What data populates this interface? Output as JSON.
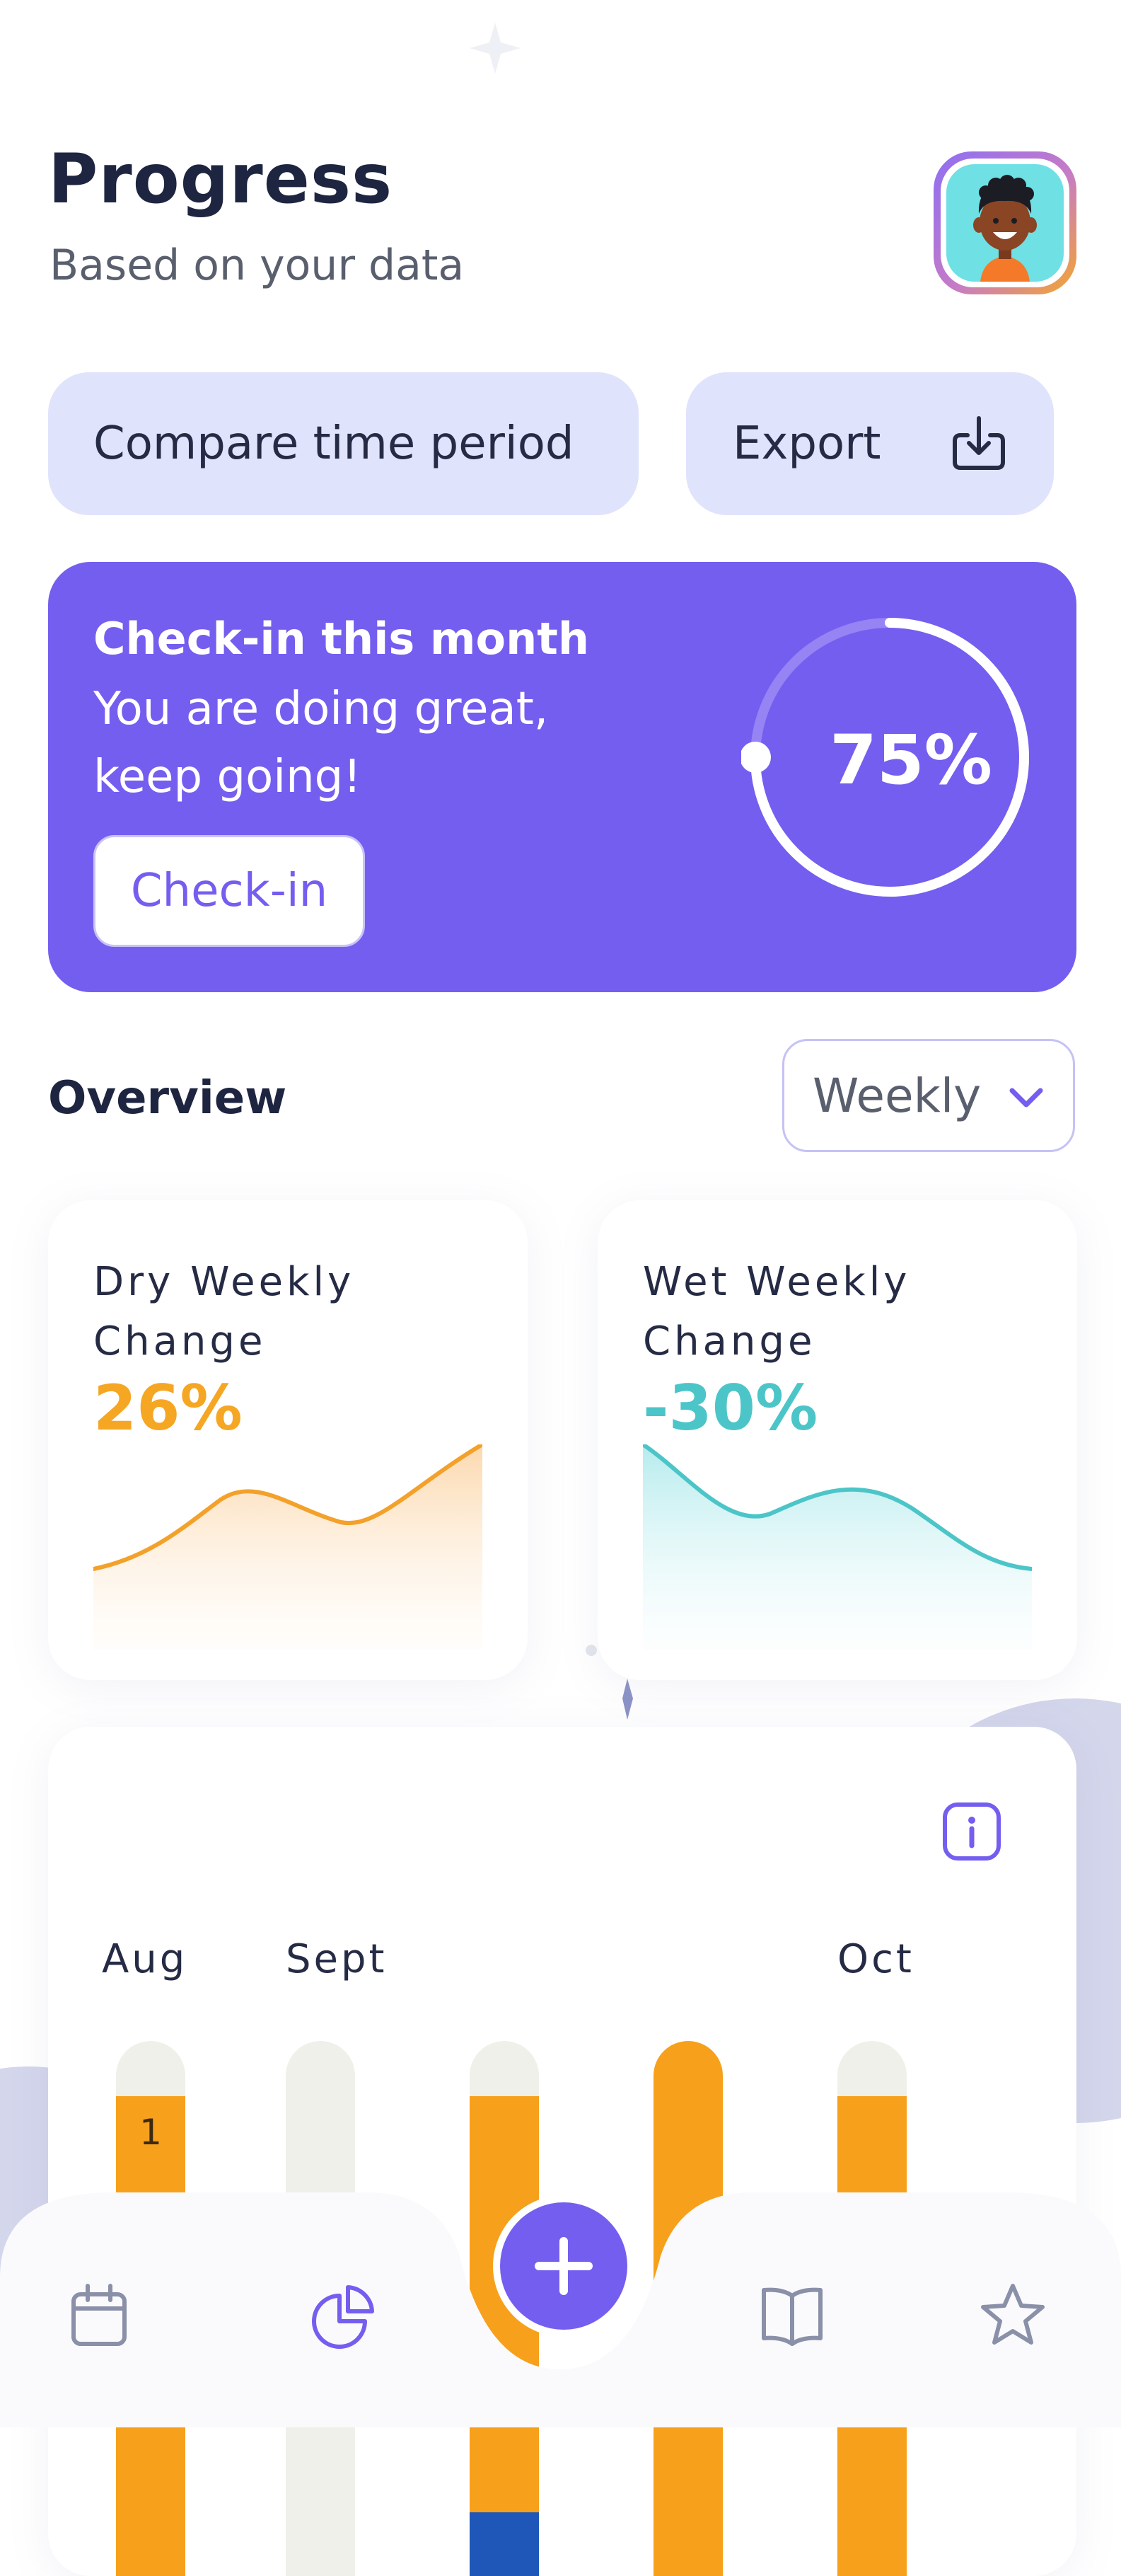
{
  "header": {
    "title": "Progress",
    "subtitle": "Based on your data"
  },
  "actions": {
    "compare_label": "Compare time period",
    "export_label": "Export"
  },
  "checkin": {
    "title": "Check-in this month",
    "message": "You are doing great, keep going!",
    "button_label": "Check-in",
    "progress_text": "75%",
    "progress": 0.75
  },
  "overview": {
    "title": "Overview",
    "period": "Weekly"
  },
  "stats": {
    "dry": {
      "label": "Dry Weekly Change",
      "value": "26%",
      "color": "#f5a623"
    },
    "wet": {
      "label": "Wet Weekly Change",
      "value": "-30%",
      "color": "#4cc5c8"
    }
  },
  "history": {
    "months": [
      "Aug",
      "Sept",
      "Oct"
    ],
    "first_bar_label": "1",
    "bar_fill_color": "#f7a01b"
  },
  "nav": {
    "items": [
      "calendar-icon",
      "pie-chart-icon",
      "add-icon",
      "book-icon",
      "star-icon"
    ],
    "accent": "#745ef0"
  }
}
